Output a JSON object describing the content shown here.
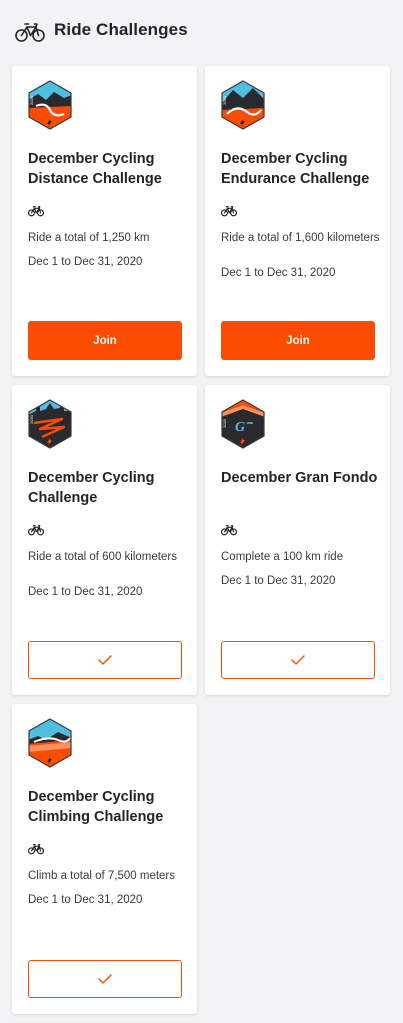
{
  "header": {
    "title": "Ride Challenges",
    "icon": "bike-icon"
  },
  "colors": {
    "accent": "#fc4c02",
    "text": "#242428",
    "background": "#f3f3f5"
  },
  "challenges": [
    {
      "title": "December Cycling Distance Challenge",
      "sport_icon": "bike-icon",
      "badge_icon": "distance-badge-icon",
      "description": "Ride a total of 1,250 km",
      "dates": "Dec 1 to Dec 31, 2020",
      "status": "not_joined",
      "button_label": "Join"
    },
    {
      "title": "December Cycling Endurance Challenge",
      "sport_icon": "bike-icon",
      "badge_icon": "endurance-badge-icon",
      "description": "Ride a total of 1,600 kilometers",
      "dates": "Dec 1 to Dec 31, 2020",
      "status": "not_joined",
      "button_label": "Join"
    },
    {
      "title": "December Cycling Challenge",
      "sport_icon": "bike-icon",
      "badge_icon": "cycling-badge-icon",
      "description": "Ride a total of 600 kilometers",
      "dates": "Dec 1 to Dec 31, 2020",
      "status": "joined",
      "button_icon": "checkmark-icon"
    },
    {
      "title": "December Gran Fondo",
      "sport_icon": "bike-icon",
      "badge_icon": "gran-fondo-badge-icon",
      "description": "Complete a 100 km ride",
      "dates": "Dec 1 to Dec 31, 2020",
      "status": "joined",
      "button_icon": "checkmark-icon"
    },
    {
      "title": "December Cycling Climbing Challenge",
      "sport_icon": "bike-icon",
      "badge_icon": "climbing-badge-icon",
      "description": "Climb a total of 7,500 meters",
      "dates": "Dec 1 to Dec 31, 2020",
      "status": "joined",
      "button_icon": "checkmark-icon"
    }
  ]
}
